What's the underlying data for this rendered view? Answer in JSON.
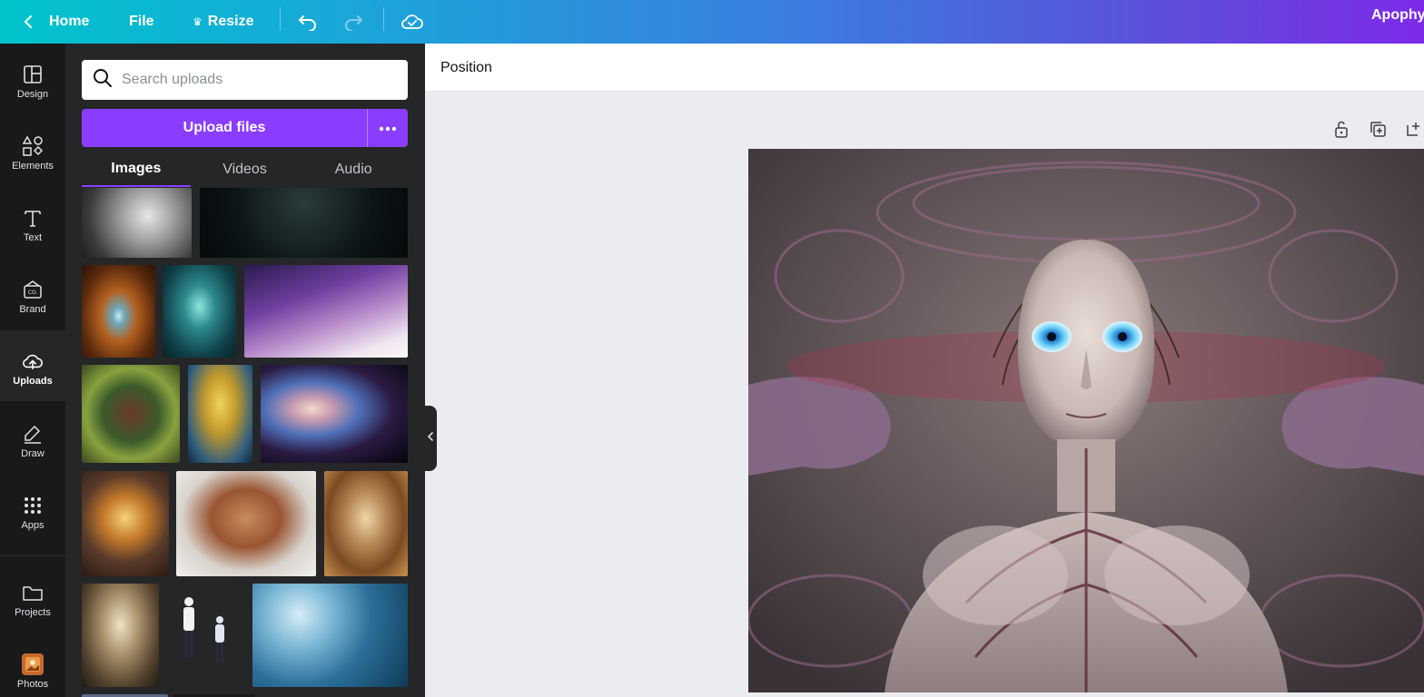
{
  "topbar": {
    "home_label": "Home",
    "file_label": "File",
    "resize_label": "Resize",
    "user_name": "Apophy"
  },
  "rail": {
    "items": [
      {
        "label": "Design",
        "icon": "layout-icon"
      },
      {
        "label": "Elements",
        "icon": "shapes-icon"
      },
      {
        "label": "Text",
        "icon": "text-icon"
      },
      {
        "label": "Brand",
        "icon": "brand-kit-icon"
      },
      {
        "label": "Uploads",
        "icon": "cloud-upload-icon",
        "active": true
      },
      {
        "label": "Draw",
        "icon": "pen-icon"
      },
      {
        "label": "Apps",
        "icon": "apps-grid-icon"
      },
      {
        "label": "Projects",
        "icon": "folder-icon"
      },
      {
        "label": "Photos",
        "icon": "photos-icon"
      }
    ]
  },
  "panel": {
    "search_placeholder": "Search uploads",
    "upload_label": "Upload files",
    "tabs": [
      {
        "label": "Images",
        "active": true
      },
      {
        "label": "Videos"
      },
      {
        "label": "Audio"
      }
    ]
  },
  "editor": {
    "position_label": "Position"
  },
  "colors": {
    "accent": "#8b3dff",
    "rail_bg": "#18191b",
    "panel_bg": "#252627",
    "editor_bg": "#ebecf0"
  }
}
